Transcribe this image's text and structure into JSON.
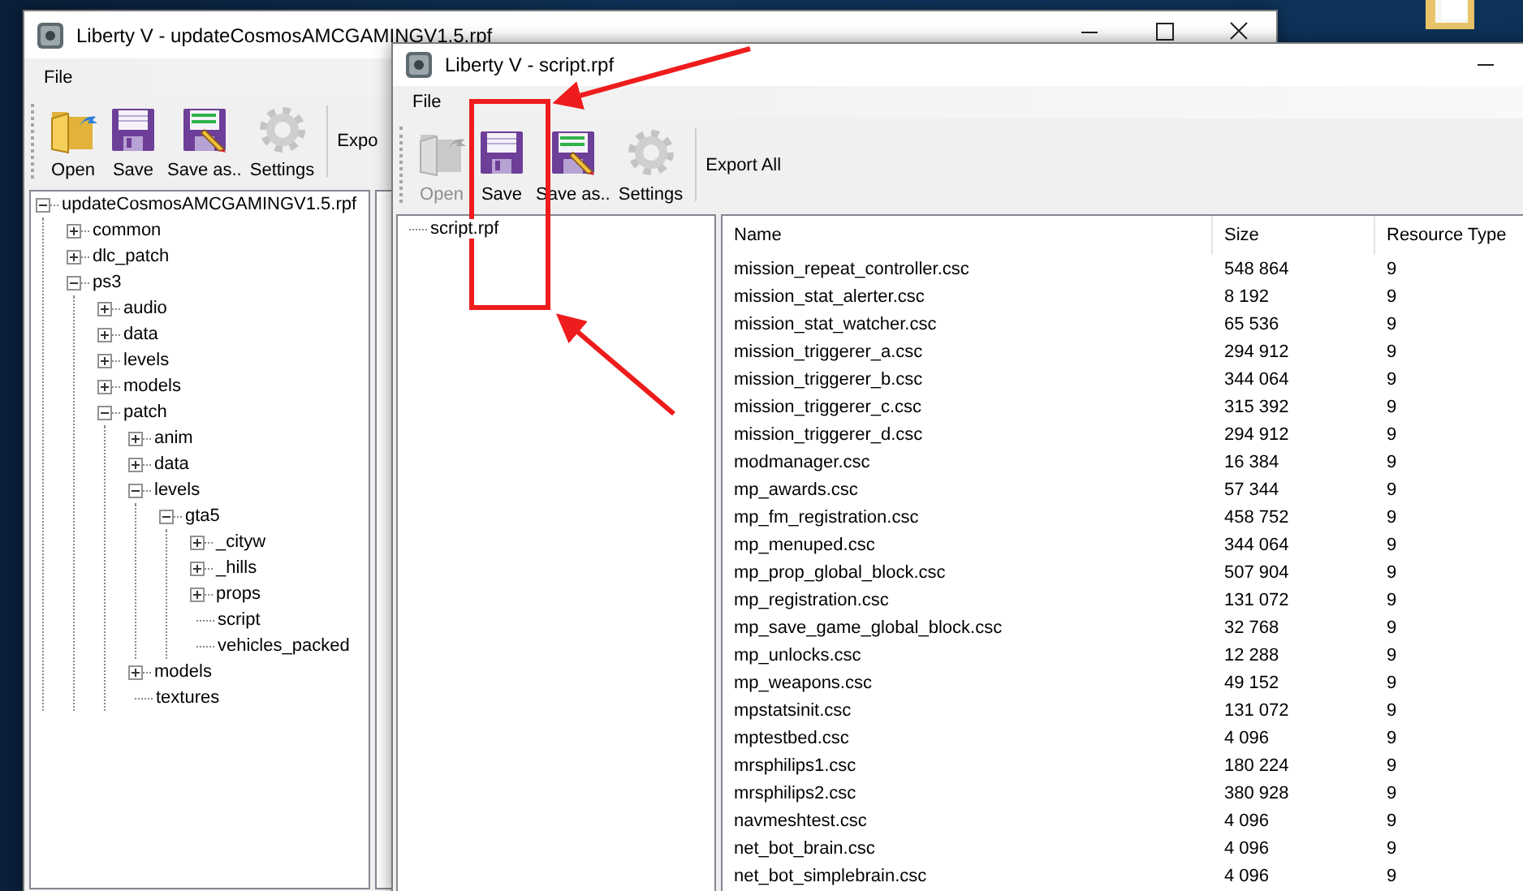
{
  "back_window": {
    "title": "Liberty V - updateCosmosAMCGAMINGV1.5.rpf",
    "menu": [
      "File"
    ],
    "toolbar": [
      {
        "kind": "open",
        "label": "Open",
        "disabled": false
      },
      {
        "kind": "save",
        "label": "Save",
        "disabled": false
      },
      {
        "kind": "saveas",
        "label": "Save as..",
        "disabled": false
      },
      {
        "kind": "settings",
        "label": "Settings",
        "disabled": false
      },
      {
        "kind": "text",
        "label": "Expo"
      }
    ],
    "tree": [
      {
        "kind": "branch",
        "label": "updateCosmosAMCGAMINGV1.5.rpf",
        "expanded": true,
        "children": [
          {
            "kind": "branch",
            "label": "common",
            "expanded": false
          },
          {
            "kind": "branch",
            "label": "dlc_patch",
            "expanded": false
          },
          {
            "kind": "branch",
            "label": "ps3",
            "expanded": true,
            "children": [
              {
                "kind": "branch",
                "label": "audio",
                "expanded": false
              },
              {
                "kind": "branch",
                "label": "data",
                "expanded": false
              },
              {
                "kind": "branch",
                "label": "levels",
                "expanded": false
              },
              {
                "kind": "branch",
                "label": "models",
                "expanded": false
              },
              {
                "kind": "branch",
                "label": "patch",
                "expanded": true,
                "children": [
                  {
                    "kind": "branch",
                    "label": "anim",
                    "expanded": false
                  },
                  {
                    "kind": "branch",
                    "label": "data",
                    "expanded": false
                  },
                  {
                    "kind": "branch",
                    "label": "levels",
                    "expanded": true,
                    "children": [
                      {
                        "kind": "branch",
                        "label": "gta5",
                        "expanded": true,
                        "children": [
                          {
                            "kind": "branch",
                            "label": "_cityw",
                            "expanded": false
                          },
                          {
                            "kind": "branch",
                            "label": "_hills",
                            "expanded": false
                          },
                          {
                            "kind": "branch",
                            "label": "props",
                            "expanded": false
                          },
                          {
                            "kind": "leaf",
                            "label": "script"
                          },
                          {
                            "kind": "leaf",
                            "label": "vehicles_packed"
                          }
                        ]
                      }
                    ]
                  },
                  {
                    "kind": "branch",
                    "label": "models",
                    "expanded": false
                  },
                  {
                    "kind": "leaf",
                    "label": "textures"
                  }
                ]
              }
            ]
          }
        ]
      }
    ]
  },
  "front_window": {
    "title": "Liberty V - script.rpf",
    "menu": [
      "File"
    ],
    "toolbar": [
      {
        "kind": "open",
        "label": "Open",
        "disabled": true
      },
      {
        "kind": "save",
        "label": "Save",
        "disabled": false
      },
      {
        "kind": "saveas",
        "label": "Save as..",
        "disabled": false
      },
      {
        "kind": "settings",
        "label": "Settings",
        "disabled": false
      },
      {
        "kind": "text",
        "label": "Export All"
      }
    ],
    "tree": [
      {
        "kind": "leaf",
        "label": "script.rpf"
      }
    ],
    "table": {
      "columns": [
        "Name",
        "Size",
        "Resource Type"
      ],
      "rows": [
        [
          "mission_repeat_controller.csc",
          "548 864",
          "9"
        ],
        [
          "mission_stat_alerter.csc",
          "8 192",
          "9"
        ],
        [
          "mission_stat_watcher.csc",
          "65 536",
          "9"
        ],
        [
          "mission_triggerer_a.csc",
          "294 912",
          "9"
        ],
        [
          "mission_triggerer_b.csc",
          "344 064",
          "9"
        ],
        [
          "mission_triggerer_c.csc",
          "315 392",
          "9"
        ],
        [
          "mission_triggerer_d.csc",
          "294 912",
          "9"
        ],
        [
          "modmanager.csc",
          "16 384",
          "9"
        ],
        [
          "mp_awards.csc",
          "57 344",
          "9"
        ],
        [
          "mp_fm_registration.csc",
          "458 752",
          "9"
        ],
        [
          "mp_menuped.csc",
          "344 064",
          "9"
        ],
        [
          "mp_prop_global_block.csc",
          "507 904",
          "9"
        ],
        [
          "mp_registration.csc",
          "131 072",
          "9"
        ],
        [
          "mp_save_game_global_block.csc",
          "32 768",
          "9"
        ],
        [
          "mp_unlocks.csc",
          "12 288",
          "9"
        ],
        [
          "mp_weapons.csc",
          "49 152",
          "9"
        ],
        [
          "mpstatsinit.csc",
          "131 072",
          "9"
        ],
        [
          "mptestbed.csc",
          "4 096",
          "9"
        ],
        [
          "mrsphilips1.csc",
          "180 224",
          "9"
        ],
        [
          "mrsphilips2.csc",
          "380 928",
          "9"
        ],
        [
          "navmeshtest.csc",
          "4 096",
          "9"
        ],
        [
          "net_bot_brain.csc",
          "4 096",
          "9"
        ],
        [
          "net_bot_simplebrain.csc",
          "4 096",
          "9"
        ]
      ]
    }
  }
}
